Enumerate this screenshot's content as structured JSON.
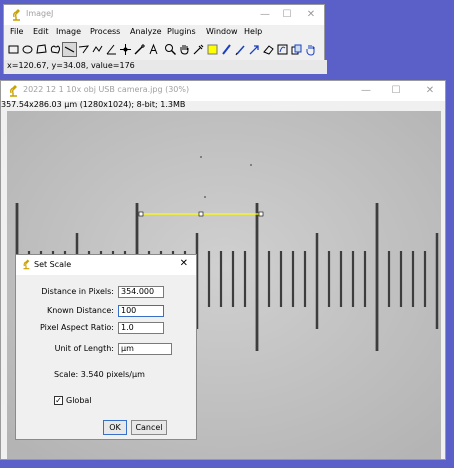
{
  "main_window": {
    "title": "ImageJ",
    "minimize": "—",
    "maximize": "☐",
    "close": "✕",
    "menu": [
      "File",
      "Edit",
      "Image",
      "Process",
      "Analyze",
      "Plugins",
      "Window",
      "Help"
    ],
    "tools": [
      "rectangle-tool",
      "oval-tool",
      "polygon-tool",
      "freehand-tool",
      "straight-line-tool",
      "angle-tool",
      "segmented-line-tool",
      "angle-measure-tool",
      "point-tool",
      "wand-tool",
      "text-tool",
      "magnifying-glass-tool",
      "scrolling-tool",
      "dropper-tool",
      "color-tool",
      "pencil-tool",
      "brush-tool",
      "flood-fill-tool",
      "eraser-tool",
      "lut-tool",
      "stack-tool",
      "hand-tool"
    ],
    "status": "x=120.67, y=34.08, value=176"
  },
  "image_window": {
    "title": "2022 12 1 10x obj USB camera.jpg (30%)",
    "minimize": "—",
    "maximize": "☐",
    "close": "✕",
    "info": "357.54x286.03 µm (1280x1024); 8-bit; 1.3MB"
  },
  "dialog": {
    "title": "Set Scale",
    "close": "✕",
    "distance_label": "Distance in Pixels:",
    "distance_value": "354.000",
    "known_label": "Known Distance:",
    "known_value": "100",
    "aspect_label": "Pixel Aspect Ratio:",
    "aspect_value": "1.0",
    "unit_label": "Unit of Length:",
    "unit_value": "µm",
    "scale_text": "Scale: 3.540 pixels/µm",
    "global_label": "Global",
    "global_checked": true,
    "ok_label": "OK",
    "cancel_label": "Cancel"
  },
  "colors": {
    "desktop": "#5b5fc8",
    "line_selection": "#ffff00",
    "image_bg": "#c4c4c4"
  }
}
